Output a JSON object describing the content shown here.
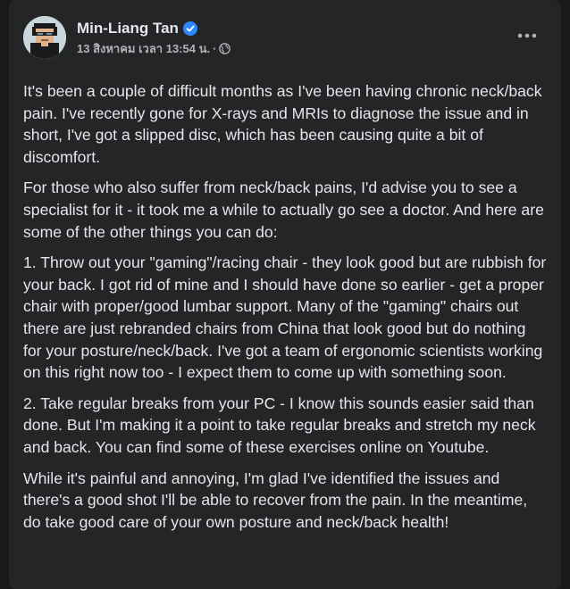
{
  "post": {
    "author": "Min-Liang Tan",
    "verified": true,
    "timestamp": "13 สิงหาคม เวลา 13:54 น.",
    "separator": "·",
    "audience_icon": "globe-icon",
    "more_icon": "more-options-icon",
    "paragraphs": [
      "It's been a couple of difficult months as I've been having chronic neck/back pain. I've recently gone for X-rays and MRIs to diagnose the issue and in short, I've got a slipped disc, which has been causing quite a bit of discomfort.",
      "For those who also suffer from neck/back pains, I'd advise you to see a specialist for it - it took me a while to actually go see a doctor. And here are some of the other things you can do:",
      "1. Throw out your \"gaming\"/racing chair - they look good but are rubbish for your back. I got rid of mine and I should have done so earlier - get a proper chair with proper/good lumbar support. Many of the \"gaming\" chairs out there are just rebranded chairs from China that look good but do nothing for your posture/neck/back. I've got a team of ergonomic scientists working on this right now too - I expect them to come up with something soon.",
      "2. Take regular breaks from your PC - I know this sounds easier said than done. But I'm making it a point to take regular breaks and stretch my neck and back. You can find some of these exercises online on Youtube.",
      "While it's painful and annoying, I'm glad I've identified the issues and there's a good shot I'll be able to recover from the pain. In the meantime, do take good care of your own posture and neck/back health!"
    ]
  },
  "colors": {
    "page_background": "#18191a",
    "card_background": "#242526",
    "primary_text": "#e4e6eb",
    "secondary_text": "#b0b3b8",
    "verified_badge": "#2d88ff"
  }
}
